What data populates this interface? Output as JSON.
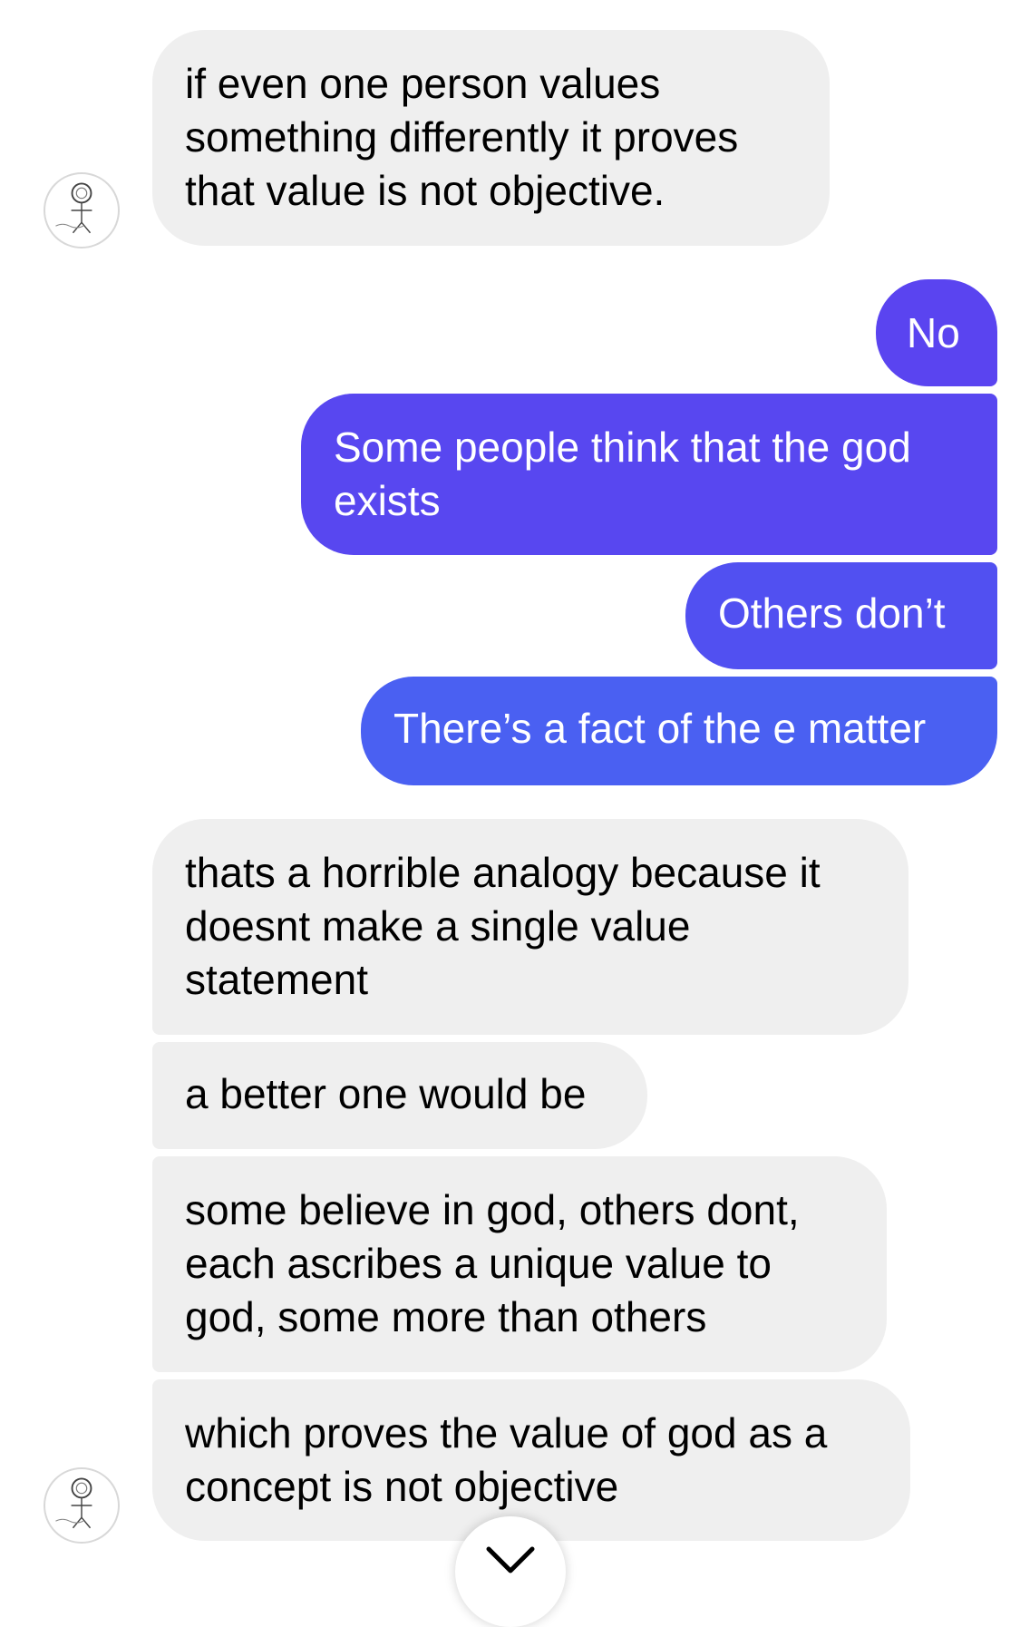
{
  "colors": {
    "incoming_bubble": "#efefef",
    "outgoing_top": "#5b43f0",
    "outgoing_bottom": "#4a63f2"
  },
  "avatar_icon": "stick-figure-avatar",
  "scroll_icon": "chevron-down-icon",
  "messages": [
    {
      "direction": "incoming",
      "lines": [
        "if even one person values",
        "something differently it proves",
        "that value is not objective."
      ]
    },
    {
      "direction": "outgoing",
      "lines": [
        "No"
      ]
    },
    {
      "direction": "outgoing",
      "lines": [
        "Some people think that the god",
        "exists"
      ]
    },
    {
      "direction": "outgoing",
      "lines": [
        "Others don’t"
      ]
    },
    {
      "direction": "outgoing",
      "lines": [
        "There’s a fact of the e matter"
      ]
    },
    {
      "direction": "incoming",
      "lines": [
        "thats a horrible analogy because it",
        "doesnt make a single value",
        "statement"
      ]
    },
    {
      "direction": "incoming",
      "lines": [
        "a better one would be"
      ]
    },
    {
      "direction": "incoming",
      "lines": [
        "some believe in god, others dont,",
        "each ascribes a unique value to",
        "god, some more than others"
      ]
    },
    {
      "direction": "incoming",
      "lines": [
        "which proves the value of god as a",
        "concept is not objective"
      ]
    }
  ]
}
